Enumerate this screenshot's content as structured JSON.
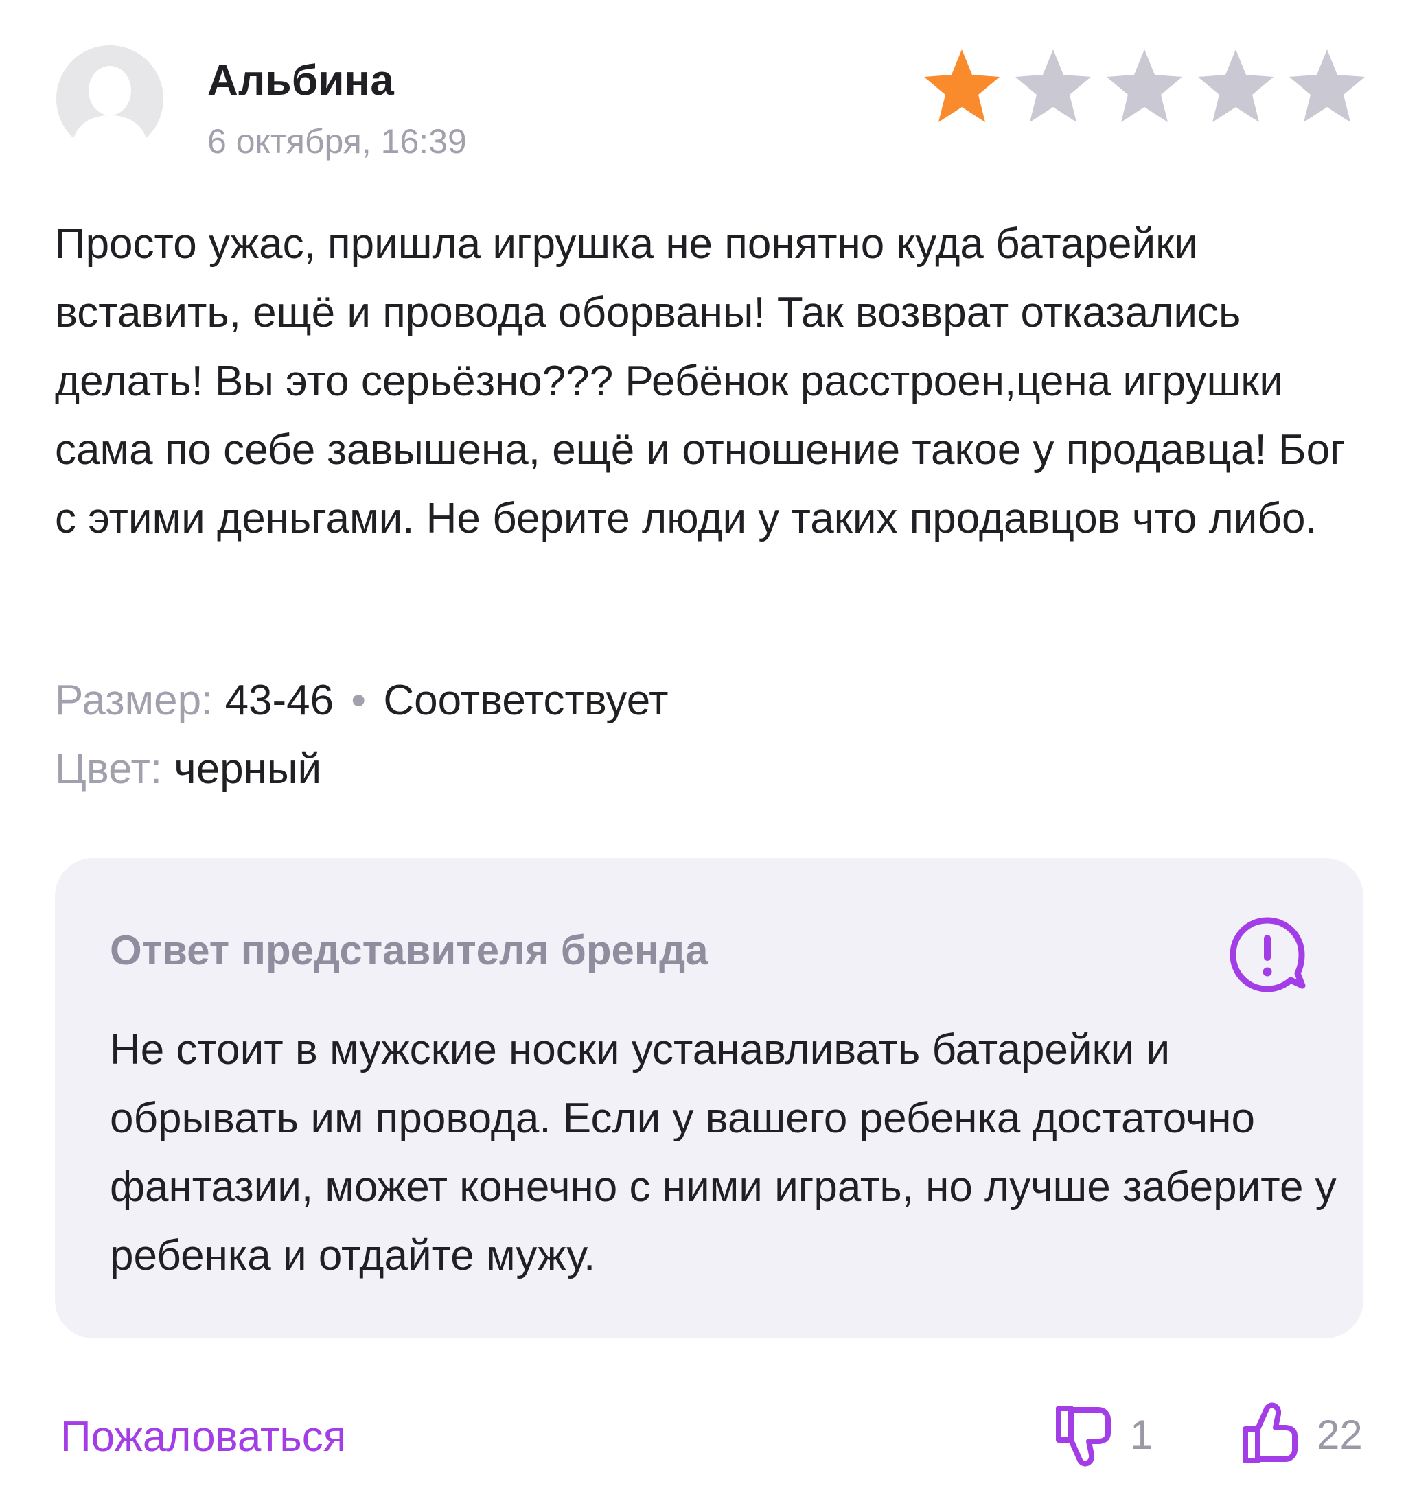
{
  "review": {
    "author": "Альбина",
    "date": "6 октября, 16:39",
    "rating": 1,
    "rating_max": 5,
    "text": "Просто ужас, пришла игрушка не понятно куда батарейки вставить, ещё и провода оборваны! Так возврат отказались делать! Вы это серьёзно??? Ребёнок расстроен,цена игрушки сама по себе завышена, ещё и отношение такое у продавца! Бог с этими деньгами. Не берите люди у таких продавцов что либо.",
    "size_label": "Размер:",
    "size_value": "43-46",
    "size_separator": "•",
    "size_fit": "Соответствует",
    "color_label": "Цвет:",
    "color_value": "черный"
  },
  "brand_reply": {
    "title": "Ответ представителя бренда",
    "text": "Не стоит в мужские носки устанавливать батарейки и обрывать им провода. Если у вашего ребенка достаточно фантазии, может конечно с ними играть, но лучше заберите у ребенка и отдайте мужу.",
    "icon": "exclamation-chat-icon"
  },
  "footer": {
    "complain_label": "Пожаловаться",
    "dislike_count": "1",
    "like_count": "22",
    "dislike_icon": "thumbs-down-icon",
    "like_icon": "thumbs-up-icon"
  },
  "colors": {
    "star_active": "#f98b2c",
    "star_inactive": "#c9c8d3",
    "accent": "#a33ee6",
    "muted_text": "#a1a0ad",
    "reply_background": "#f2f1f8"
  }
}
